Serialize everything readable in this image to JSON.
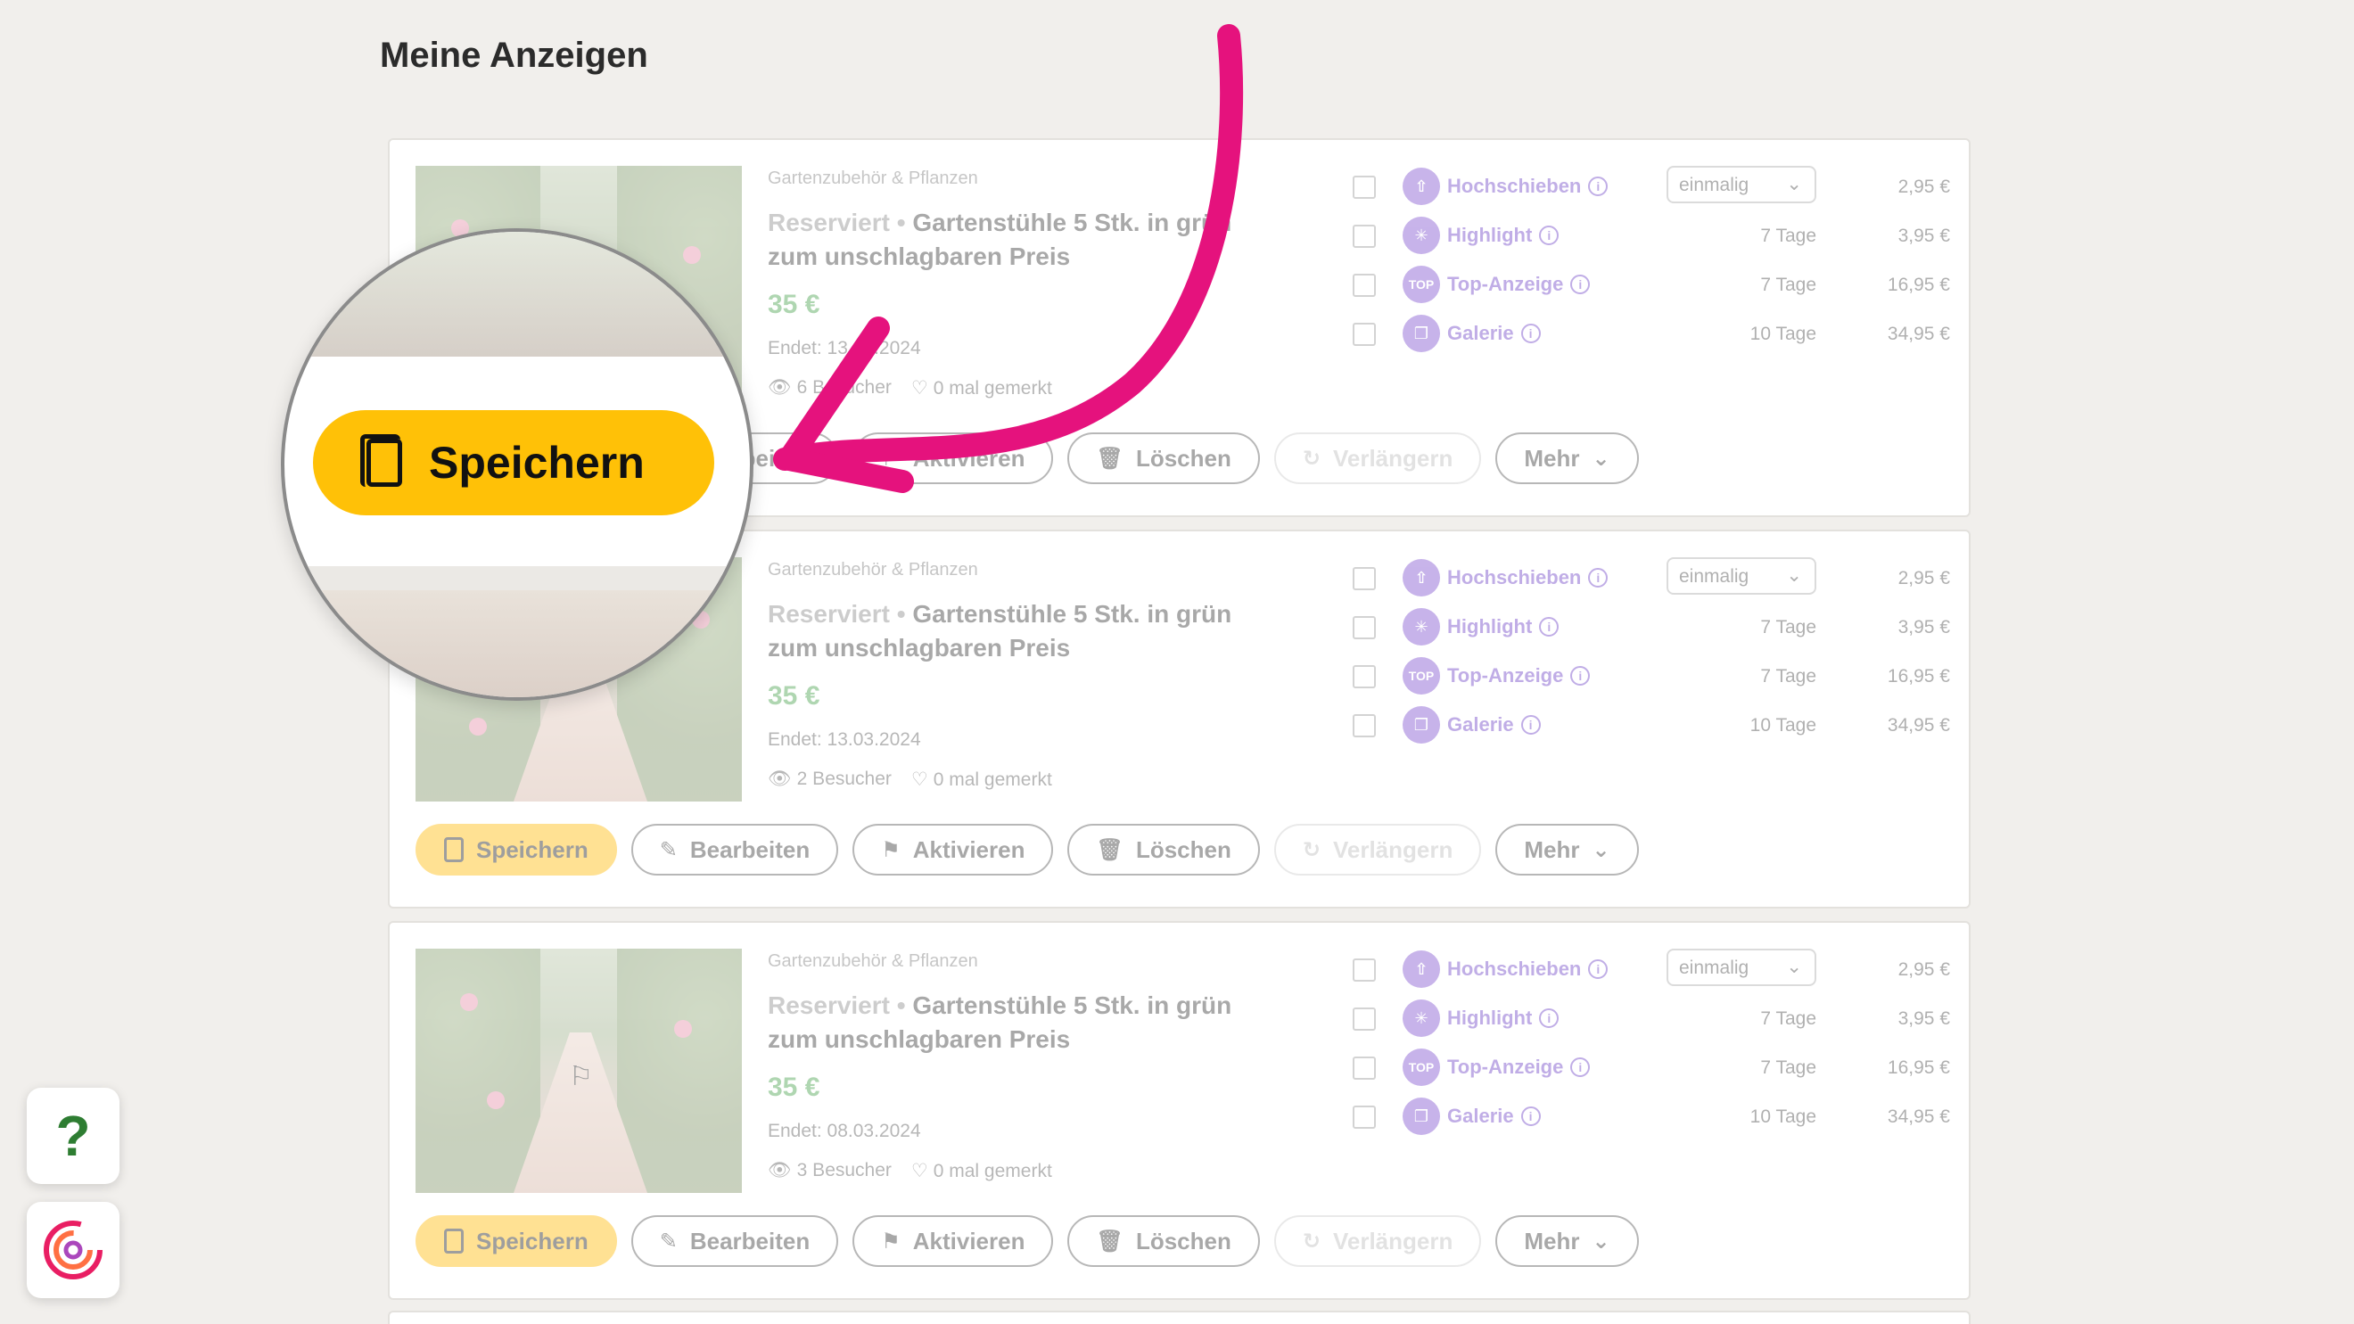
{
  "page": {
    "title": "Meine Anzeigen"
  },
  "listings": [
    {
      "category": "Gartenzubehör & Pflanzen",
      "status": "Reserviert",
      "status_sep": "•",
      "title": "Gartenstühle 5 Stk. in grün zum unschlagbaren Preis",
      "price": "35 €",
      "ends": "Endet: 13.03.2024",
      "visitors": "6 Besucher",
      "watched": "0 mal gemerkt"
    },
    {
      "category": "Gartenzubehör & Pflanzen",
      "status": "Reserviert",
      "status_sep": "•",
      "title": "Gartenstühle 5 Stk. in grün zum unschlagbaren Preis",
      "price": "35 €",
      "ends": "Endet: 13.03.2024",
      "visitors": "2 Besucher",
      "watched": "0 mal gemerkt"
    },
    {
      "category": "Gartenzubehör & Pflanzen",
      "status": "Reserviert",
      "status_sep": "•",
      "title": "Gartenstühle 5 Stk. in grün zum unschlagbaren Preis",
      "price": "35 €",
      "ends": "Endet: 08.03.2024",
      "visitors": "3 Besucher",
      "watched": "0 mal gemerkt"
    }
  ],
  "features": {
    "hochschieben": {
      "label": "Hochschieben",
      "select_value": "einmalig",
      "price": "2,95 €"
    },
    "highlight": {
      "label": "Highlight",
      "duration": "7 Tage",
      "price": "3,95 €"
    },
    "top": {
      "label": "Top-Anzeige",
      "icon_text": "TOP",
      "duration": "7 Tage",
      "price": "16,95 €"
    },
    "galerie": {
      "label": "Galerie",
      "duration": "10 Tage",
      "price": "34,95 €"
    }
  },
  "actions": {
    "save": "Speichern",
    "edit": "Bearbeiten",
    "activate": "Aktivieren",
    "delete": "Löschen",
    "extend": "Verlängern",
    "more": "Mehr"
  },
  "magnifier": {
    "button_label": "Speichern"
  },
  "widgets": {
    "help_label": "?"
  },
  "colors": {
    "accent": "#ffb800",
    "arrow": "#e5127d",
    "feature": "#7c4dce",
    "price": "#43a047"
  }
}
